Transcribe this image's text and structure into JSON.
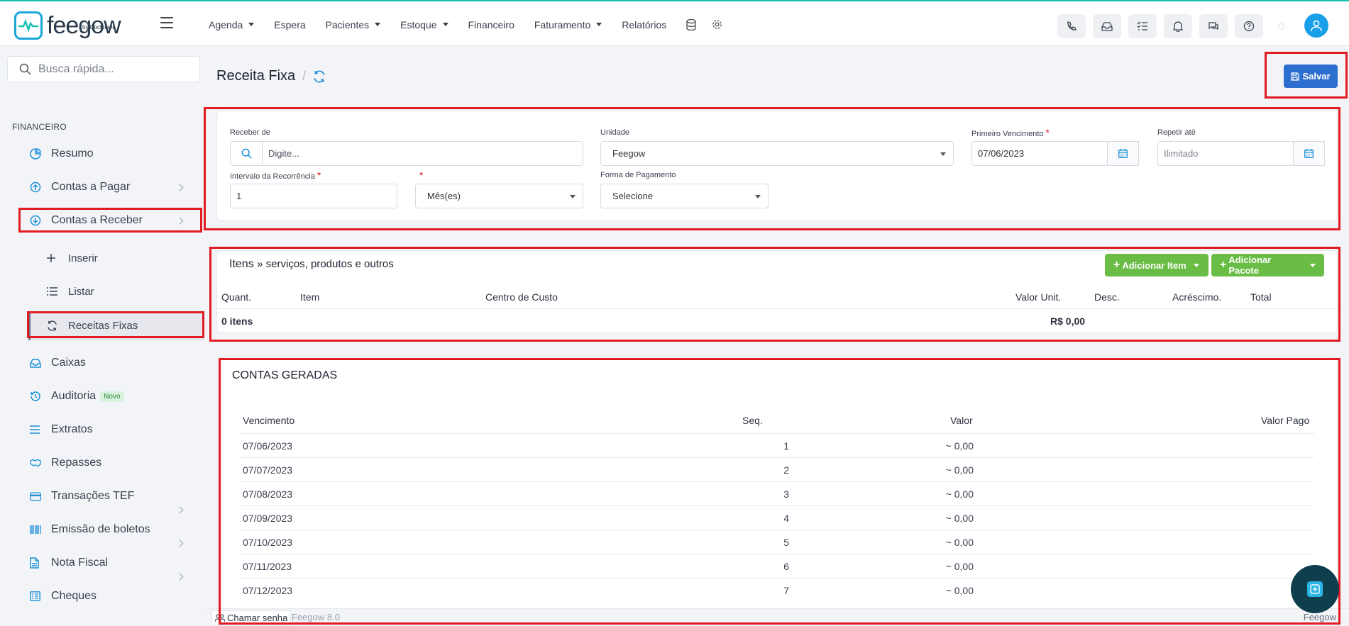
{
  "brand": {
    "name": "feegow",
    "by": "by Doctoralia"
  },
  "topnav": {
    "menu": [
      {
        "label": "Agenda",
        "dropdown": true
      },
      {
        "label": "Espera",
        "dropdown": false
      },
      {
        "label": "Pacientes",
        "dropdown": true
      },
      {
        "label": "Estoque",
        "dropdown": true
      },
      {
        "label": "Financeiro",
        "dropdown": false
      },
      {
        "label": "Faturamento",
        "dropdown": true
      },
      {
        "label": "Relatórios",
        "dropdown": false
      }
    ],
    "icons": [
      "database-icon",
      "gear-icon"
    ],
    "tools": [
      "phone-icon",
      "inbox-icon",
      "checklist-icon",
      "bell-icon",
      "chat-icon",
      "help-icon"
    ]
  },
  "sidebar": {
    "search_placeholder": "Busca rápida...",
    "section": "FINANCEIRO",
    "items": {
      "resumo": "Resumo",
      "contas_pagar": "Contas a Pagar",
      "contas_receber": "Contas a Receber",
      "inserir": "Inserir",
      "listar": "Listar",
      "receitas_fixas": "Receitas Fixas",
      "caixas": "Caixas",
      "auditoria": "Auditoria",
      "auditoria_badge": "Novo",
      "extratos": "Extratos",
      "repasses": "Repasses",
      "transacoes_tef": "Transações TEF",
      "emissao_boletos": "Emissão de boletos",
      "nota_fiscal": "Nota Fiscal",
      "cheques": "Cheques"
    }
  },
  "page": {
    "title": "Receita Fixa",
    "save_label": "Salvar"
  },
  "form": {
    "receber_de": {
      "label": "Receber de",
      "placeholder": "Digite..."
    },
    "unidade": {
      "label": "Unidade",
      "value": "Feegow"
    },
    "primeiro_vencimento": {
      "label": "Primeiro Vencimento",
      "value": "07/06/2023"
    },
    "repetir_ate": {
      "label": "Repetir até",
      "placeholder": "Ilimitado"
    },
    "intervalo": {
      "label": "Intervalo da Recorrência",
      "value": "1"
    },
    "periodo": {
      "value": "Mês(es)"
    },
    "forma_pagamento": {
      "label": "Forma de Pagamento",
      "value": "Selecione"
    }
  },
  "itens": {
    "title_main": "Itens",
    "title_sub": "» serviços, produtos e outros",
    "add_item": "Adicionar Item",
    "add_pacote": "Adicionar Pacote",
    "columns": [
      "Quant.",
      "Item",
      "Centro de Custo",
      "Valor Unit.",
      "Desc.",
      "Acréscimo.",
      "Total"
    ],
    "count": "0 itens",
    "total": "R$ 0,00"
  },
  "contas": {
    "title": "CONTAS GERADAS",
    "columns": {
      "vencimento": "Vencimento",
      "seq": "Seq.",
      "valor": "Valor",
      "valor_pago": "Valor Pago"
    },
    "rows": [
      {
        "vencimento": "07/06/2023",
        "seq": "1",
        "valor": "~ 0,00"
      },
      {
        "vencimento": "07/07/2023",
        "seq": "2",
        "valor": "~ 0,00"
      },
      {
        "vencimento": "07/08/2023",
        "seq": "3",
        "valor": "~ 0,00"
      },
      {
        "vencimento": "07/09/2023",
        "seq": "4",
        "valor": "~ 0,00"
      },
      {
        "vencimento": "07/10/2023",
        "seq": "5",
        "valor": "~ 0,00"
      },
      {
        "vencimento": "07/11/2023",
        "seq": "6",
        "valor": "~ 0,00"
      },
      {
        "vencimento": "07/12/2023",
        "seq": "7",
        "valor": "~ 0,00"
      }
    ]
  },
  "footer": {
    "chamar_senha": "Chamar senha",
    "version": "Feegow 8.0",
    "brand_right": "Feegow"
  },
  "colors": {
    "primary": "#2c6fcf",
    "success": "#69bd45",
    "highlight": "#e01b22",
    "accent": "#1a8fd8"
  }
}
